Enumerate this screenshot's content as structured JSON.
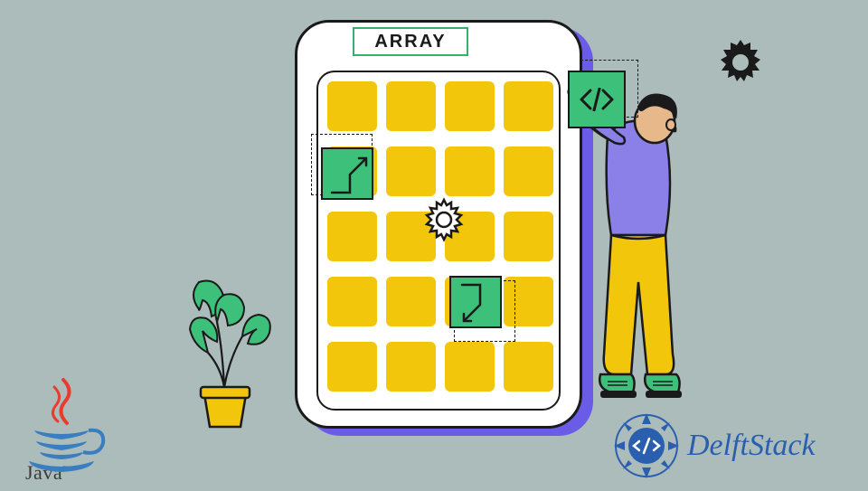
{
  "label": "ARRAY",
  "brand": {
    "java": "Java",
    "tm": "™",
    "delft": "DelftStack"
  },
  "colors": {
    "bg": "#acbcbb",
    "accent_purple": "#6a5ce6",
    "accent_yellow": "#f2c60b",
    "accent_green": "#3cc07a",
    "dark": "#1a1a1a",
    "delft_blue": "#2a5fb0",
    "java_red": "#e83c2e",
    "java_blue": "#3a7ebf"
  },
  "grid": {
    "rows": 5,
    "cols": 4
  },
  "icons": {
    "code": "</>",
    "gear_dark": "gear-icon",
    "gear_light": "gear-icon"
  }
}
